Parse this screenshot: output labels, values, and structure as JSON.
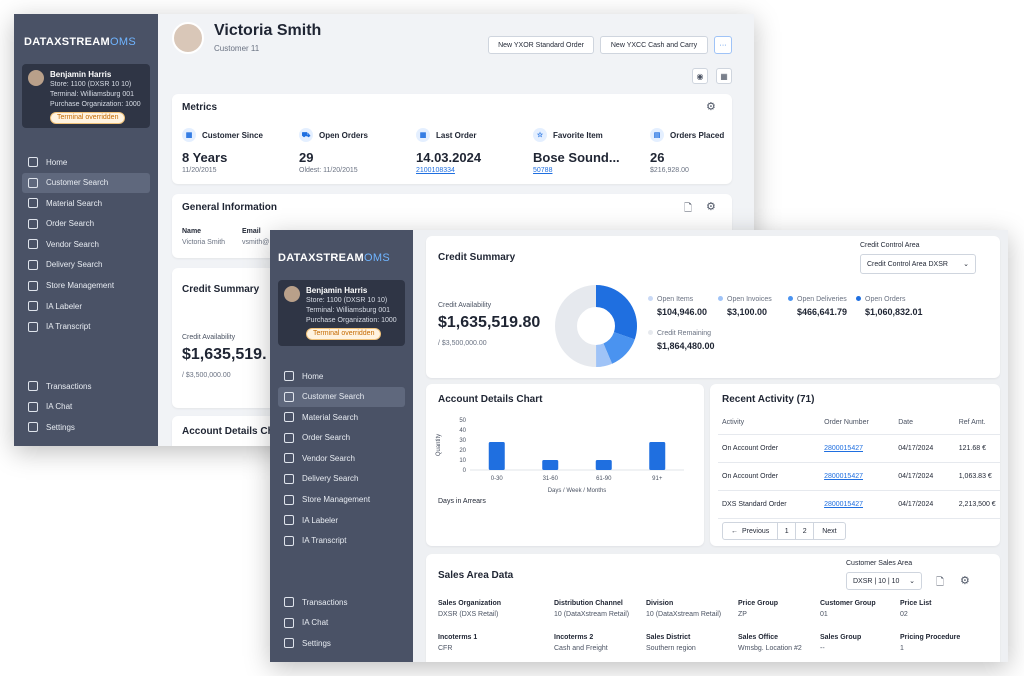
{
  "back": {
    "logo": {
      "main": "DATAXSTREAM",
      "suffix": "OMS"
    },
    "user": {
      "name": "Benjamin Harris",
      "store": "Store: 1100 (DXSR 10 10)",
      "terminal": "Terminal: Williamsburg 001",
      "org": "Purchase Organization: 1000",
      "badge": "Terminal overridden"
    },
    "nav": [
      "Home",
      "Customer Search",
      "Material Search",
      "Order Search",
      "Vendor Search",
      "Delivery Search",
      "Store Management",
      "IA Labeler",
      "IA Transcript"
    ],
    "nav_bottom": [
      "Transactions",
      "IA Chat",
      "Settings"
    ],
    "customer_name": "Victoria Smith",
    "customer_sub": "Customer 11",
    "buttons": {
      "new1": "New YXOR Standard Order",
      "new2": "New YXCC Cash and Carry",
      "more": "···"
    },
    "metrics": {
      "title": "Metrics",
      "items": [
        {
          "label": "Customer Since",
          "value": "8 Years",
          "sub": "11/20/2015"
        },
        {
          "label": "Open Orders",
          "value": "29",
          "sub": "Oldest: 11/20/2015"
        },
        {
          "label": "Last Order",
          "value": "14.03.2024",
          "sub": "2100108334"
        },
        {
          "label": "Favorite Item",
          "value": "Bose Sound...",
          "sub": "50788"
        },
        {
          "label": "Orders Placed",
          "value": "26",
          "sub": "$216,928.00"
        }
      ]
    },
    "general": {
      "title": "General Information",
      "name_label": "Name",
      "name_value": "Victoria Smith",
      "email_label": "Email",
      "email_value": "vsmith@"
    },
    "credit": {
      "title": "Credit Summary",
      "avail_label": "Credit Availability",
      "avail_value": "$1,635,519.",
      "limit": "/ $3,500,000.00"
    },
    "account_title": "Account Details Cha"
  },
  "front": {
    "logo": {
      "main": "DATAXSTREAM",
      "suffix": "OMS"
    },
    "user": {
      "name": "Benjamin Harris",
      "store": "Store: 1100 (DXSR 10 10)",
      "terminal": "Terminal: Williamsburg 001",
      "org": "Purchase Organization: 1000",
      "badge": "Terminal overridden"
    },
    "nav": [
      "Home",
      "Customer Search",
      "Material Search",
      "Order Search",
      "Vendor Search",
      "Delivery Search",
      "Store Management",
      "IA Labeler",
      "IA Transcript"
    ],
    "nav_bottom": [
      "Transactions",
      "IA Chat",
      "Settings"
    ],
    "credit": {
      "title": "Credit Summary",
      "control_label": "Credit Control Area",
      "control_value": "Credit Control Area DXSR",
      "avail_label": "Credit Availability",
      "avail_value": "$1,635,519.80",
      "limit": "/ $3,500,000.00",
      "legend": [
        {
          "label": "Open Items",
          "value": "$104,946.00",
          "color": "#c9d9f5"
        },
        {
          "label": "Open Invoices",
          "value": "$3,100.00",
          "color": "#9fc3f7"
        },
        {
          "label": "Open Deliveries",
          "value": "$466,641.79",
          "color": "#4a93f0"
        },
        {
          "label": "Open Orders",
          "value": "$1,060,832.01",
          "color": "#1f6fe0"
        }
      ],
      "remaining": {
        "label": "Credit Remaining",
        "value": "$1,864,480.00",
        "color": "#e6e9ee"
      }
    },
    "account_chart": {
      "title": "Account Details Chart",
      "footer": "Days in Arrears"
    },
    "recent": {
      "title": "Recent Activity (71)",
      "headers": [
        "Activity",
        "Order Number",
        "Date",
        "Ref Amt."
      ],
      "rows": [
        [
          "On Account Order",
          "2800015427",
          "04/17/2024",
          "121.68 €"
        ],
        [
          "On Account Order",
          "2800015427",
          "04/17/2024",
          "1,063.83 €"
        ],
        [
          "DXS Standard Order",
          "2800015427",
          "04/17/2024",
          "2,213,500 €"
        ]
      ],
      "pager": {
        "prev": "Previous",
        "p1": "1",
        "p2": "2",
        "next": "Next"
      }
    },
    "sales": {
      "title": "Sales Area Data",
      "area_label": "Customer Sales Area",
      "area_value": "DXSR | 10 | 10",
      "row1": [
        {
          "h": "Sales Organization",
          "v": "DXSR (DXS Retail)"
        },
        {
          "h": "Distribution Channel",
          "v": "10 (DataXstream Retail)"
        },
        {
          "h": "Division",
          "v": "10 (DataXstream Retail)"
        },
        {
          "h": "Price Group",
          "v": "ZP"
        },
        {
          "h": "Customer Group",
          "v": "01"
        },
        {
          "h": "Price List",
          "v": "02"
        }
      ],
      "row2": [
        {
          "h": "Incoterms 1",
          "v": "CFR"
        },
        {
          "h": "Incoterms 2",
          "v": "Cash and Freight"
        },
        {
          "h": "Sales District",
          "v": "Southern region"
        },
        {
          "h": "Sales Office",
          "v": "Wmsbg. Location #2"
        },
        {
          "h": "Sales Group",
          "v": "--"
        },
        {
          "h": "Pricing Procedure",
          "v": "1"
        }
      ]
    }
  },
  "chart_data": {
    "type": "bar",
    "title": "Account Details Chart",
    "ylabel": "Quantity",
    "xlabel": "Days / Week / Months",
    "categories": [
      "0-30",
      "31-60",
      "61-90",
      "91+"
    ],
    "values": [
      28,
      10,
      10,
      28
    ],
    "ylim": [
      0,
      50
    ],
    "yticks": [
      0,
      10,
      20,
      30,
      40,
      50
    ],
    "color": "#1f6fe0"
  }
}
